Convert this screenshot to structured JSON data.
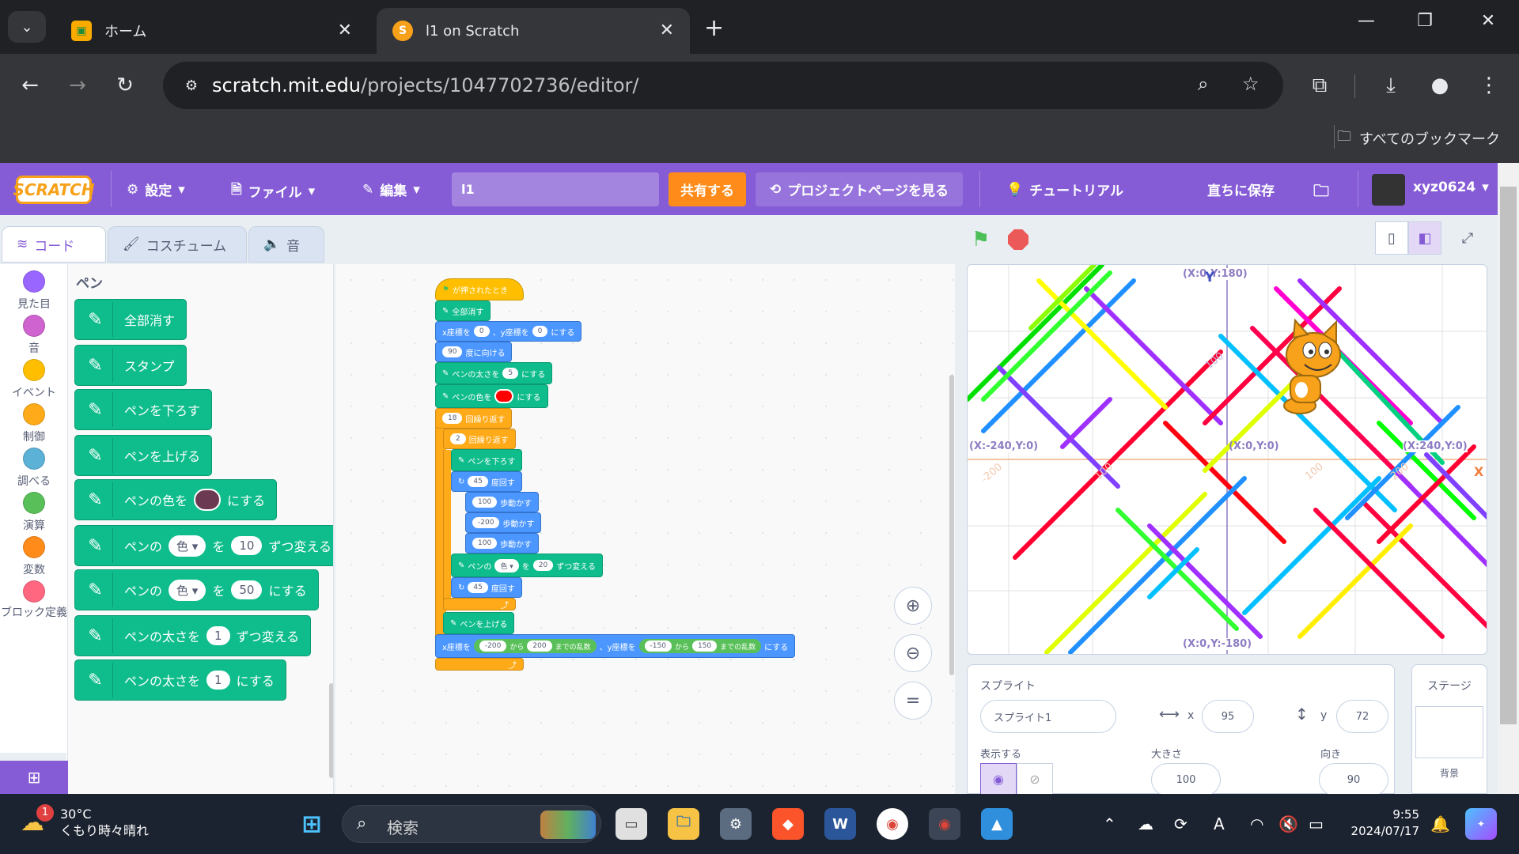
{
  "browser": {
    "tabs": [
      {
        "title": "ホーム",
        "icon": "google-classroom-icon"
      },
      {
        "title": "l1 on Scratch",
        "icon": "scratch-icon",
        "active": true
      }
    ],
    "url_host": "scratch.mit.edu",
    "url_path": "/projects/1047702736/editor/",
    "bookmarks_all": "すべてのブックマーク"
  },
  "scratch": {
    "logo": "SCRATCH",
    "menu": {
      "settings": "設定",
      "file": "ファイル",
      "edit": "編集",
      "project_name": "l1",
      "share": "共有する",
      "project_page": "プロジェクトページを見る",
      "tutorials": "チュートリアル",
      "save_now": "直ちに保存",
      "username": "xyz0624"
    },
    "tabs": {
      "code": "コード",
      "costumes": "コスチューム",
      "sounds": "音"
    },
    "categories": [
      {
        "label": "見た目",
        "color": "#9966ff"
      },
      {
        "label": "音",
        "color": "#cf63cf"
      },
      {
        "label": "イベント",
        "color": "#ffbf00"
      },
      {
        "label": "制御",
        "color": "#ffab19"
      },
      {
        "label": "調べる",
        "color": "#5cb1d6"
      },
      {
        "label": "演算",
        "color": "#59c059"
      },
      {
        "label": "変数",
        "color": "#ff8c1a"
      },
      {
        "label": "ブロック定義",
        "color": "#ff6680"
      },
      {
        "label": "ペン",
        "color": "#0fbd8c"
      }
    ],
    "palette": {
      "title": "ペン",
      "erase_all": "全部消す",
      "stamp": "スタンプ",
      "pen_down": "ペンを下ろす",
      "pen_up": "ペンを上げる",
      "set_color_pre": "ペンの色を",
      "set_color_post": "にする",
      "change_param_pre": "ペンの",
      "param_color": "色",
      "change_param_mid": "を",
      "change_param_val": "10",
      "change_param_post": "ずつ変える",
      "set_param_val": "50",
      "set_param_post": "にする",
      "size_pre": "ペンの太さを",
      "size_change_val": "1",
      "size_change_post": "ずつ変える",
      "size_set_val": "1",
      "size_set_post": "にする"
    },
    "script": {
      "when_flag": "が押されたとき",
      "erase_all": "全部消す",
      "goto_x_label": "x座標を",
      "goto_x": "0",
      "goto_y_label": "、y座標を",
      "goto_y": "0",
      "goto_post": "にする",
      "point_dir": "90",
      "point_label": "度に向ける",
      "pen_size_label": "ペンの太さを",
      "pen_size": "5",
      "pen_size_post": "にする",
      "pen_color_label": "ペンの色を",
      "pen_color_post": "にする",
      "repeat_outer": "18",
      "repeat_label": "回繰り返す",
      "repeat_inner": "2",
      "pen_down": "ペンを下ろす",
      "turn1": "45",
      "turn_label": "度回す",
      "move1": "100",
      "move_label": "歩動かす",
      "move2": "-200",
      "move3": "100",
      "change_color_pre": "ペンの",
      "change_color_param": "色",
      "change_color_mid": "を",
      "change_color_val": "20",
      "change_color_post": "ずつ変える",
      "turn2": "45",
      "pen_up": "ペンを上げる",
      "rand_x_label": "x座標を",
      "rand_x_from": "-200",
      "rand_from": "から",
      "rand_x_to": "200",
      "rand_to": "までの乱数",
      "rand_y_label": "、y座標を",
      "rand_y_from": "-150",
      "rand_y_to": "150",
      "rand_post": "にする"
    },
    "stage_labels": {
      "top": "(X:0,Y:180)",
      "bottom": "(X:0,Y:-180)",
      "left": "(X:-240,Y:0)",
      "right": "(X:240,Y:0)",
      "center": "(X:0,Y:0)",
      "y_axis": "Y",
      "x_axis": "X",
      "tick_pos_y": "100",
      "tick_neg_x": "-200",
      "tick_neg_x2": "100",
      "tick_pos_x": "100",
      "tick_pos_x2": "200"
    },
    "sprite_panel": {
      "title": "スプライト",
      "sprite_name": "スプライト1",
      "x_label": "x",
      "x": "95",
      "y_label": "y",
      "y": "72",
      "show_label": "表示する",
      "size_label": "大きさ",
      "size": "100",
      "direction_label": "向き",
      "direction": "90"
    },
    "stage_panel": {
      "title": "ステージ",
      "backdrop_label": "背景"
    }
  },
  "taskbar": {
    "temperature": "30°C",
    "weather": "くもり時々晴れ",
    "weather_badge": "1",
    "search_placeholder": "検索",
    "time": "9:55",
    "date": "2024/07/17"
  }
}
